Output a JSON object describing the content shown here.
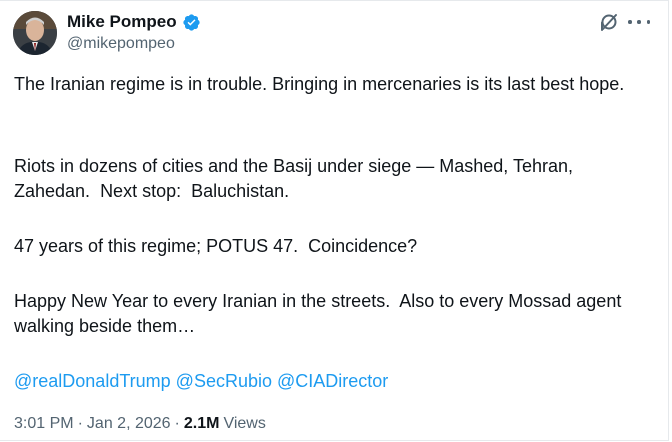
{
  "author": {
    "name": "Mike Pompeo",
    "handle": "@mikepompeo",
    "verified_color": "#1d9bf0"
  },
  "header_actions": {
    "icons": [
      "grok-icon",
      "more-options-icon"
    ]
  },
  "tweet": {
    "paragraphs": [
      "The Iranian regime is in trouble. Bringing in mercenaries is its last best hope.",
      "Riots in dozens of cities and the Basij under siege — Mashed, Tehran, Zahedan.  Next stop:  Baluchistan.",
      "47 years of this regime; POTUS 47.  Coincidence?",
      "Happy New Year to every Iranian in the streets.  Also to every Mossad agent walking beside them…"
    ],
    "mentions": [
      "@realDonaldTrump",
      "@SecRubio",
      "@CIADirector"
    ]
  },
  "meta": {
    "time": "3:01 PM",
    "separator": "·",
    "date": "Jan 2, 2026",
    "views_count": "2.1M",
    "views_label": "Views"
  },
  "colors": {
    "text": "#0f1419",
    "secondary": "#536471",
    "link": "#1d9bf0"
  }
}
